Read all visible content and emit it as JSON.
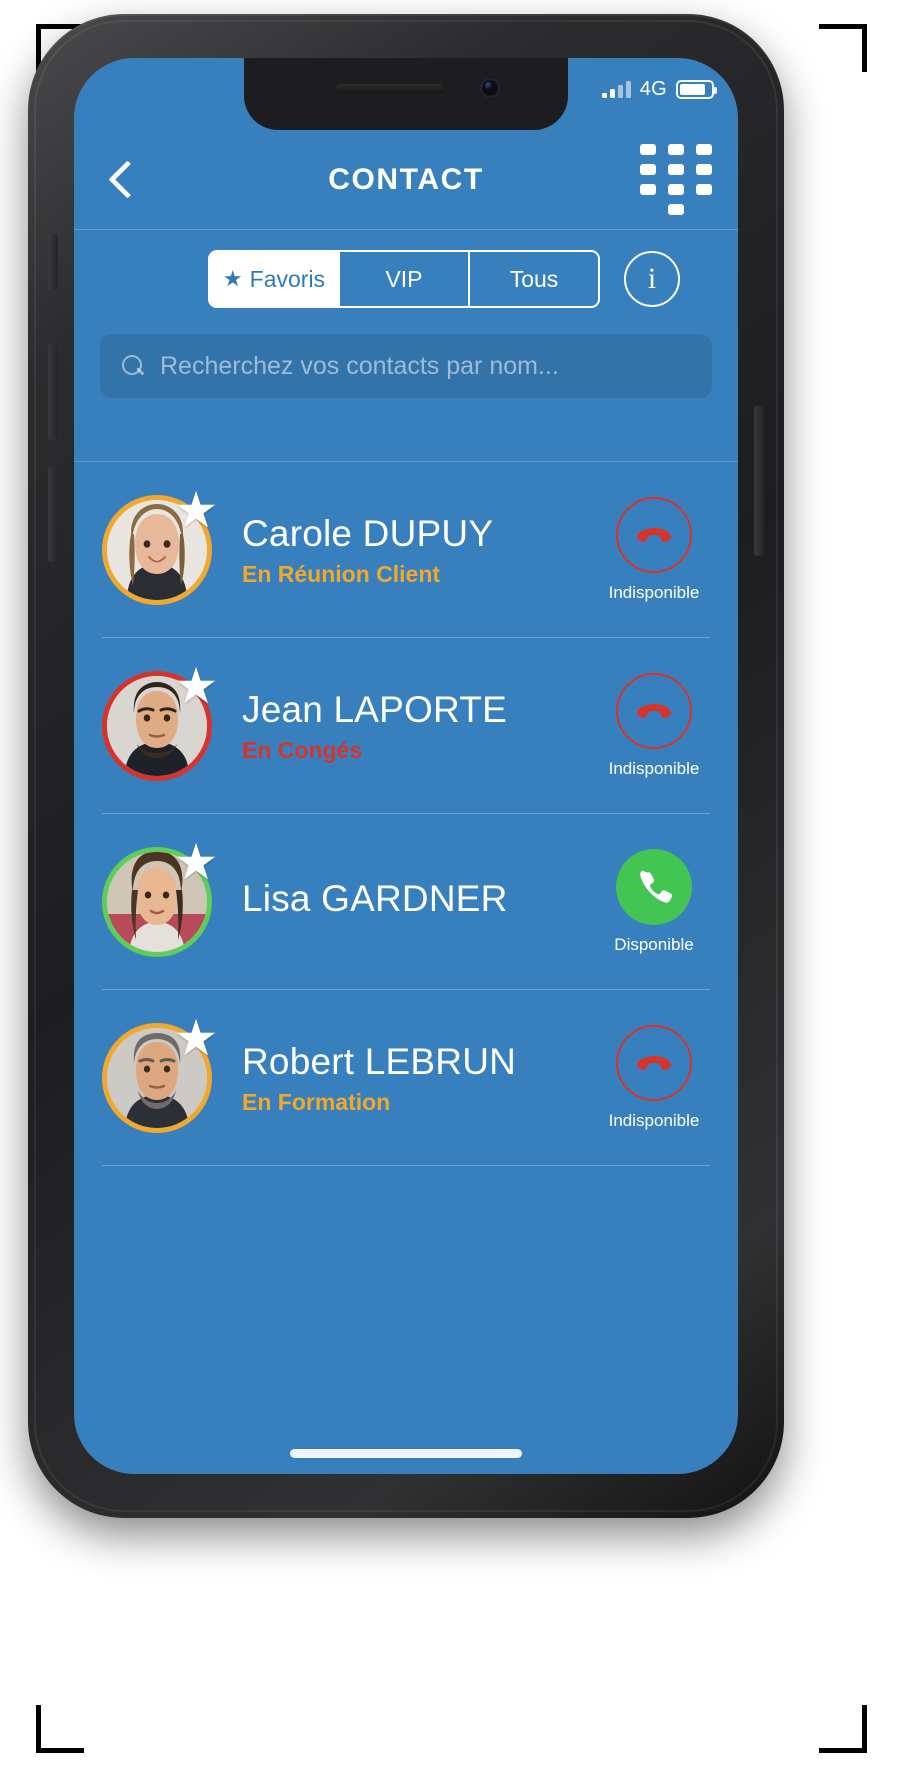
{
  "statusbar": {
    "network_label": "4G",
    "signal_icon": "signal-bars-icon",
    "battery_icon": "battery-icon",
    "battery_level": 82
  },
  "header": {
    "title": "CONTACT",
    "back_icon": "back-chevron-icon",
    "dialpad_icon": "dialpad-icon"
  },
  "filters": {
    "segments": [
      {
        "label": "Favoris",
        "active": true,
        "icon": "star-icon"
      },
      {
        "label": "VIP",
        "active": false
      },
      {
        "label": "Tous",
        "active": false
      }
    ],
    "info_button_label": "i",
    "info_icon": "info-circle-icon"
  },
  "search": {
    "placeholder": "Recherchez vos contacts par nom...",
    "value": "",
    "icon": "search-icon"
  },
  "contacts": [
    {
      "name": "Carole DUPUY",
      "status": "En Réunion Client",
      "status_color": "#f0a92e",
      "ring_color": "#f0a92e",
      "favorite": true,
      "availability": "Indisponible",
      "available": false,
      "call_icon": "phone-hangup-icon"
    },
    {
      "name": "Jean LAPORTE",
      "status": "En Congés",
      "status_color": "#d6332c",
      "ring_color": "#d6332c",
      "favorite": true,
      "availability": "Indisponible",
      "available": false,
      "call_icon": "phone-hangup-icon"
    },
    {
      "name": "Lisa GARDNER",
      "status": "",
      "status_color": "#5ece5a",
      "ring_color": "#5ece5a",
      "favorite": true,
      "availability": "Disponible",
      "available": true,
      "call_icon": "phone-call-icon"
    },
    {
      "name": "Robert LEBRUN",
      "status": "En Formation",
      "status_color": "#f0a92e",
      "ring_color": "#f0a92e",
      "favorite": true,
      "availability": "Indisponible",
      "available": false,
      "call_icon": "phone-hangup-icon"
    }
  ],
  "theme": {
    "app_blue": "#3880bd",
    "accent_white": "#ffffff",
    "status_orange": "#f0a92e",
    "status_red": "#d6332c",
    "status_green": "#42c553"
  }
}
